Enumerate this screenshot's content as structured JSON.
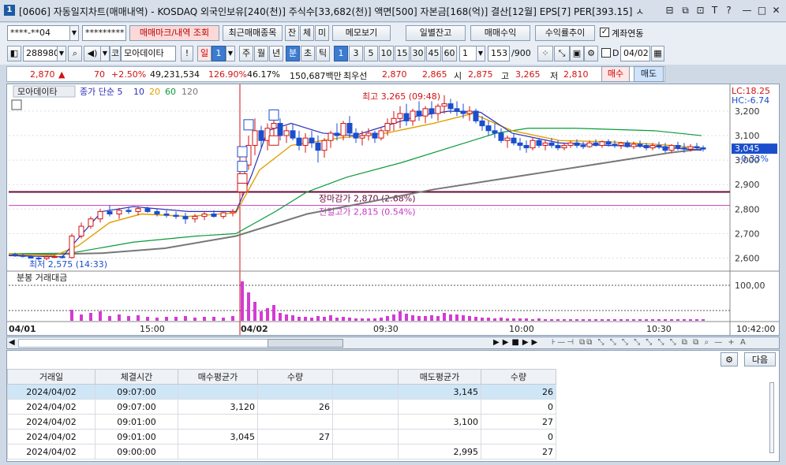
{
  "title": {
    "badge": "1",
    "text": "[0606] 자동일지차트(매매내역) - KOSDAQ 외국인보유[240(천)] 주식수[33,682(천)] 액면[500] 자본금[168(억)] 결산[12월] EPS[7] PER[393.15] ㅅ",
    "buttons": [
      "⊟",
      "⧉",
      "⊡",
      "⊞",
      "T",
      "T",
      "?",
      "—",
      "□",
      "✕"
    ]
  },
  "row1": {
    "account": "****-**04",
    "password": "*********",
    "buttons": [
      "매매마크/내역 조회",
      "최근매매종목",
      "잔",
      "체",
      "미",
      "메모보기",
      "일별잔고",
      "매매수익",
      "수익률추이"
    ],
    "checkbox_label": "계좌연동"
  },
  "row2": {
    "code": "288980",
    "market": "코",
    "name": "모아데이타",
    "period_buttons": [
      "!",
      "일",
      "1",
      "주",
      "월",
      "년",
      "분",
      "초",
      "틱"
    ],
    "interval_buttons": [
      "1",
      "3",
      "5",
      "10",
      "15",
      "30",
      "45",
      "60"
    ],
    "count": "1",
    "range": "153",
    "range_total": "/900",
    "checkbox_label": "D",
    "date": "04/02"
  },
  "pricebar": {
    "price": "2,870",
    "arrow": "▲",
    "change": "70",
    "rate": "+2.50%",
    "volume": "49,231,534",
    "vol_rate": "126.90%",
    "turnover": "46.17%",
    "amount": "150,687백만",
    "best_label": "최우선",
    "ask": "2,870",
    "bid": "2,865",
    "open_label": "시",
    "open": "2,875",
    "high_label": "고",
    "high": "3,265",
    "low_label": "저",
    "low": "2,810",
    "buy": "매수",
    "sell": "매도"
  },
  "chart_data": {
    "type": "candlestick",
    "legend_name": "모아데이타",
    "legend_series": [
      {
        "name": "종가 단순 5",
        "color": "#2d2db8"
      },
      {
        "name": "10",
        "color": "#2d2db8"
      },
      {
        "name": "20",
        "color": "#e0a000"
      },
      {
        "name": "60",
        "color": "#0a9a3a"
      },
      {
        "name": "120",
        "color": "#777777"
      }
    ],
    "y_ticks": [
      "3,200",
      "3,100",
      "3,000",
      "2,900",
      "2,800",
      "2,700",
      "2,600"
    ],
    "ylim": [
      2550,
      3290
    ],
    "x_ticks": [
      "04/01",
      "15:00",
      "04/02",
      "09:30",
      "10:00",
      "10:30"
    ],
    "last_time": "10:42:00",
    "lc_label": "LC:18.25",
    "hc_label": "HC:-6.74",
    "current_price": "3,045",
    "current_rate": "-0.33%",
    "high_label": "최고 3,265 (09:48)",
    "low_label": "최저 2,575 (14:33)",
    "close_label": "장마감가 2,870 (2.68%)",
    "prev_high_label": "전일고가 2,815 (0.54%)",
    "sub_title": "분봉 거래대금",
    "sub_y_tick": "100,00"
  },
  "table": {
    "headers": [
      "거래일",
      "체결시간",
      "매수평균가",
      "수량",
      "",
      "매도평균가",
      "수량"
    ],
    "rows": [
      {
        "date": "2024/04/02",
        "time": "09:07:00",
        "buy_avg": "",
        "buy_qty": "",
        "blank": "",
        "sell_avg": "3,145",
        "sell_qty": "26"
      },
      {
        "date": "2024/04/02",
        "time": "09:07:00",
        "buy_avg": "3,120",
        "buy_qty": "26",
        "blank": "",
        "sell_avg": "",
        "sell_qty": "0"
      },
      {
        "date": "2024/04/02",
        "time": "09:01:00",
        "buy_avg": "",
        "buy_qty": "",
        "blank": "",
        "sell_avg": "3,100",
        "sell_qty": "27"
      },
      {
        "date": "2024/04/02",
        "time": "09:01:00",
        "buy_avg": "3,045",
        "buy_qty": "27",
        "blank": "",
        "sell_avg": "",
        "sell_qty": "0"
      },
      {
        "date": "2024/04/02",
        "time": "09:00:00",
        "buy_avg": "",
        "buy_qty": "",
        "blank": "",
        "sell_avg": "2,995",
        "sell_qty": "27"
      }
    ],
    "next_button": "다음"
  }
}
